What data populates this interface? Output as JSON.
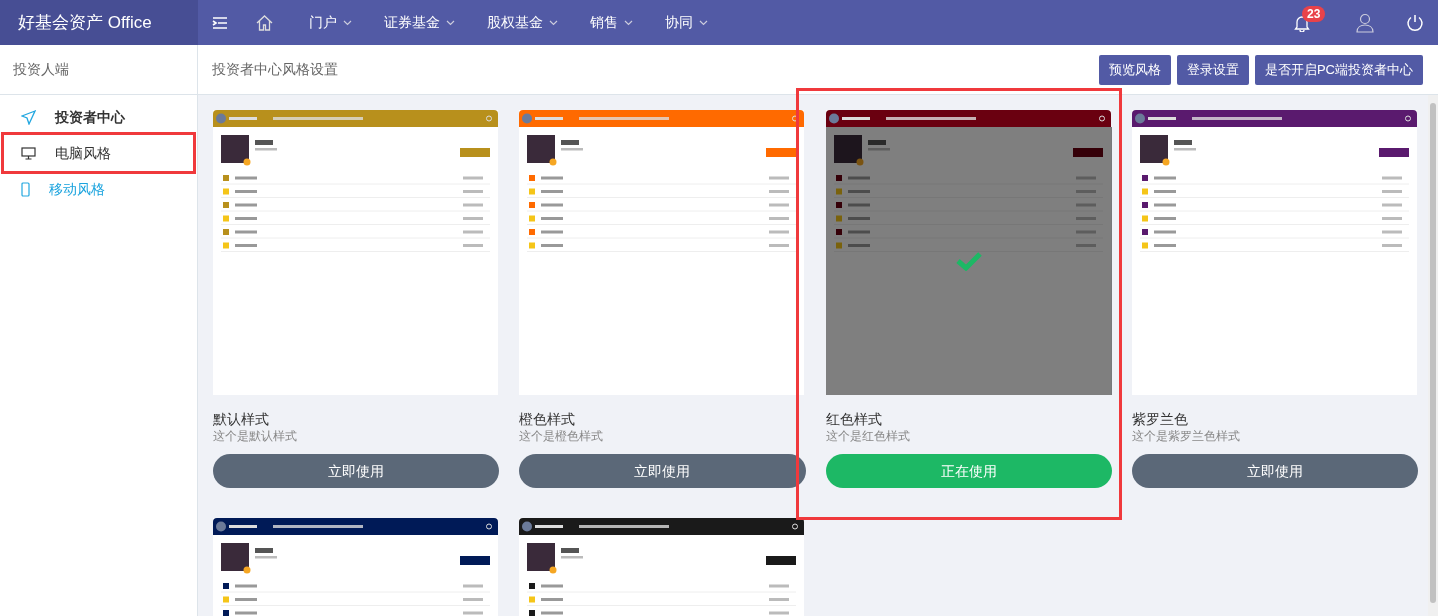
{
  "app": {
    "title": "好基会资产 Office"
  },
  "nav": [
    {
      "label": "门户"
    },
    {
      "label": "证券基金"
    },
    {
      "label": "股权基金"
    },
    {
      "label": "销售"
    },
    {
      "label": "协同"
    }
  ],
  "notifications": {
    "count": "23"
  },
  "sidebar": {
    "title": "投资人端",
    "items": [
      {
        "kind": "heading",
        "label": "投资者中心",
        "selected": false,
        "highlighted": false
      },
      {
        "kind": "desktop",
        "label": "电脑风格",
        "selected": false,
        "highlighted": true
      },
      {
        "kind": "mobile",
        "label": "移动风格",
        "selected": true,
        "highlighted": false
      }
    ]
  },
  "page": {
    "title": "投资者中心风格设置",
    "buttons": [
      "预览风格",
      "登录设置",
      "是否开启PC端投资者中心"
    ]
  },
  "themes": [
    {
      "name": "默认样式",
      "description": "这个是默认样式",
      "button": "立即使用",
      "selected": false,
      "highlighted": false,
      "color": "#b8901c"
    },
    {
      "name": "橙色样式",
      "description": "这个是橙色样式",
      "button": "立即使用",
      "selected": false,
      "highlighted": false,
      "color": "#ff6a00"
    },
    {
      "name": "红色样式",
      "description": "这个是红色样式",
      "button": "正在使用",
      "selected": true,
      "highlighted": true,
      "color": "#6a0010"
    },
    {
      "name": "紫罗兰色",
      "description": "这个是紫罗兰色样式",
      "button": "立即使用",
      "selected": false,
      "highlighted": false,
      "color": "#5a1a6e"
    },
    {
      "selected": false,
      "highlighted": false,
      "color": "#001a57"
    },
    {
      "selected": false,
      "highlighted": false,
      "color": "#1a1a1a"
    }
  ]
}
